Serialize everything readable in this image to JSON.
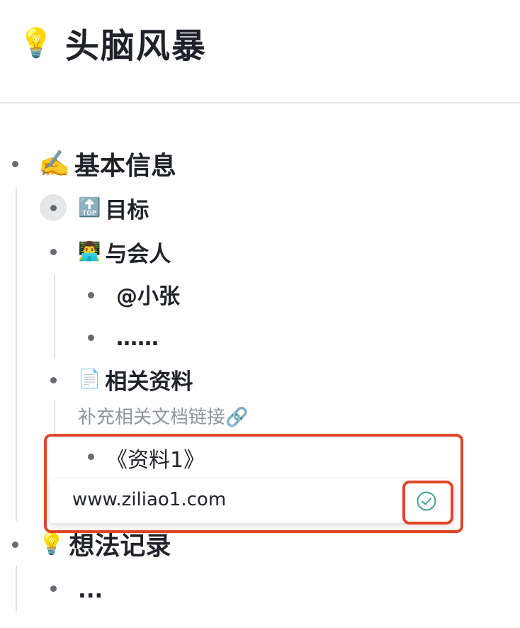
{
  "doc": {
    "title": "头脑风暴",
    "title_icon": "light-bulb-icon"
  },
  "outline": {
    "section_basic": {
      "icon": "writing-hand-icon",
      "label": "基本信息"
    },
    "goal": {
      "icon": "top-arrow-icon",
      "label": "目标"
    },
    "attendees": {
      "icon": "technologist-icon",
      "label": "与会人"
    },
    "attendee_1": "@小张",
    "attendee_more": "……",
    "materials": {
      "icon": "page-icon",
      "label": "相关资料"
    },
    "materials_hint": "补充相关文档链接🔗",
    "material_1": "《资料1》",
    "link_editor": {
      "value": "www.ziliao1.com",
      "confirm_icon": "check-circle-icon"
    },
    "section_ideas": {
      "icon": "light-bulb-icon",
      "label": "想法记录"
    },
    "ideas_more": "..."
  },
  "colors": {
    "highlight": "#e0452b",
    "confirm": "#3aa77e",
    "bullet": "#646a73",
    "hint_text": "#8f959e"
  }
}
